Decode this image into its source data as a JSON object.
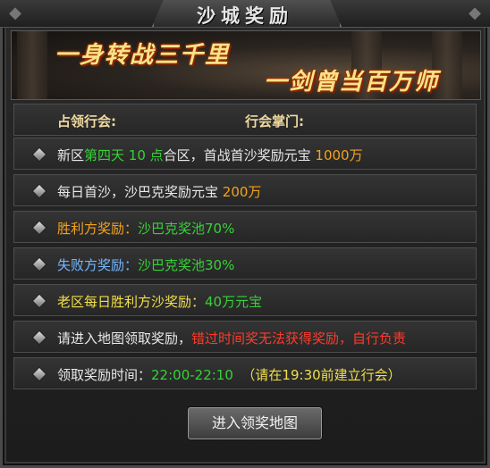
{
  "title": "沙城奖励",
  "banner": {
    "slogan_left": "一身转战三千里",
    "slogan_right": "一剑曾当百万师"
  },
  "header": {
    "guild_label": "占领行会:",
    "leader_label": "行会掌门:"
  },
  "rows": [
    {
      "segments": [
        {
          "text": "新区",
          "color": "white"
        },
        {
          "text": "第四天 10 点",
          "color": "green"
        },
        {
          "text": "合区，首战首沙奖励元宝 ",
          "color": "white"
        },
        {
          "text": "1000万",
          "color": "orange"
        }
      ]
    },
    {
      "segments": [
        {
          "text": "每日首沙，沙巴克奖励元宝 ",
          "color": "white"
        },
        {
          "text": "200万",
          "color": "orange"
        }
      ]
    },
    {
      "segments": [
        {
          "text": "胜利方奖励：",
          "color": "orange"
        },
        {
          "text": "沙巴克奖池70%",
          "color": "green"
        }
      ]
    },
    {
      "segments": [
        {
          "text": "失败方奖励：",
          "color": "blue"
        },
        {
          "text": "沙巴克奖池30%",
          "color": "green"
        }
      ]
    },
    {
      "segments": [
        {
          "text": "老区每日胜利方沙奖励：",
          "color": "yellow"
        },
        {
          "text": "40万元宝",
          "color": "green"
        }
      ]
    },
    {
      "segments": [
        {
          "text": "请进入地图领取奖励，",
          "color": "white"
        },
        {
          "text": "错过时间奖无法获得奖励，自行负责",
          "color": "red"
        }
      ]
    },
    {
      "segments": [
        {
          "text": "领取奖励时间：",
          "color": "white"
        },
        {
          "text": "22:00-22:10",
          "color": "green"
        },
        {
          "text": "  （请在19:30前建立行会）",
          "color": "yellow"
        }
      ]
    }
  ],
  "button": {
    "label": "进入领奖地图"
  },
  "colors": {
    "white": "#e8e8e8",
    "green": "#37d137",
    "orange": "#f3a21c",
    "blue": "#73b7ff",
    "yellow": "#f2df4a",
    "red": "#ff3a2a"
  }
}
